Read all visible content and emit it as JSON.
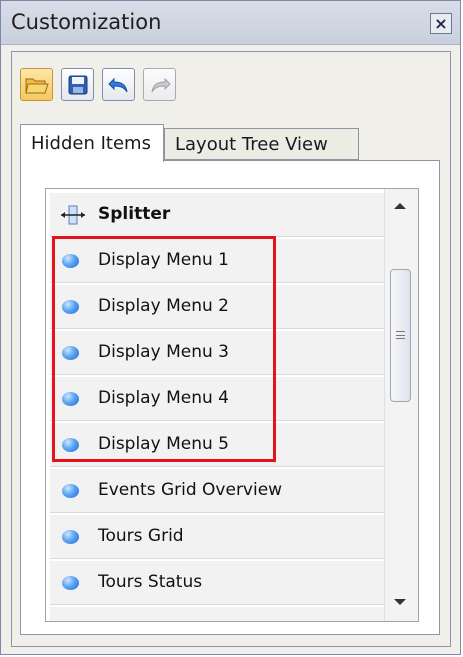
{
  "window": {
    "title": "Customization",
    "close_icon": "close-icon"
  },
  "toolbar": {
    "buttons": [
      {
        "icon": "open-folder-icon",
        "state": "active"
      },
      {
        "icon": "save-icon",
        "state": "normal"
      },
      {
        "icon": "undo-icon",
        "state": "normal"
      },
      {
        "icon": "redo-icon",
        "state": "disabled"
      }
    ]
  },
  "tabs": [
    {
      "label": "Hidden Items",
      "selected": true
    },
    {
      "label": "Layout Tree View",
      "selected": false
    }
  ],
  "list": {
    "items": [
      {
        "label": "Splitter",
        "icon": "splitter-icon",
        "bold": true
      },
      {
        "label": "Display Menu 1",
        "icon": "blue-circle-icon"
      },
      {
        "label": "Display Menu 2",
        "icon": "blue-circle-icon"
      },
      {
        "label": "Display Menu 3",
        "icon": "blue-circle-icon"
      },
      {
        "label": "Display Menu 4",
        "icon": "blue-circle-icon"
      },
      {
        "label": "Display Menu 5",
        "icon": "blue-circle-icon"
      },
      {
        "label": "Events Grid Overview",
        "icon": "blue-circle-icon"
      },
      {
        "label": "Tours Grid",
        "icon": "blue-circle-icon"
      },
      {
        "label": "Tours Status",
        "icon": "blue-circle-icon"
      }
    ],
    "highlight_color": "#e8121f"
  }
}
